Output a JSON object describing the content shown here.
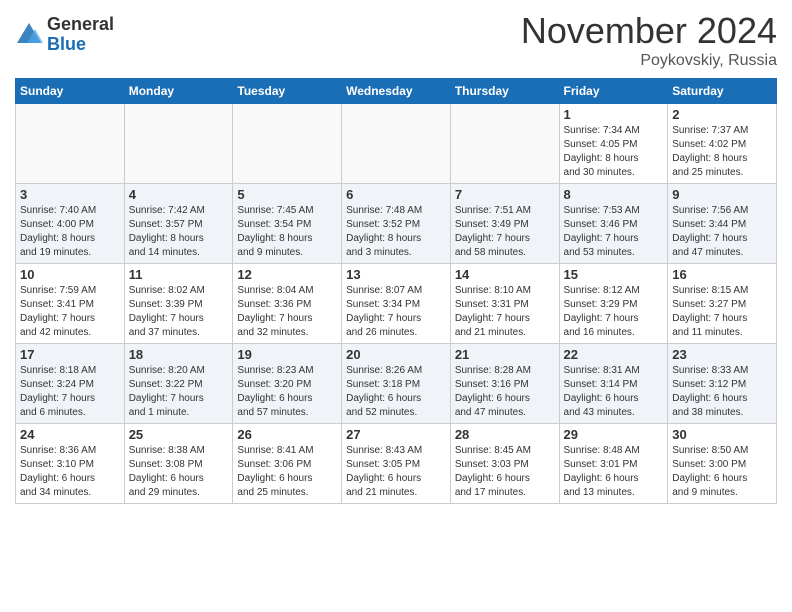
{
  "header": {
    "logo_general": "General",
    "logo_blue": "Blue",
    "month_title": "November 2024",
    "location": "Poykovskiy, Russia"
  },
  "weekdays": [
    "Sunday",
    "Monday",
    "Tuesday",
    "Wednesday",
    "Thursday",
    "Friday",
    "Saturday"
  ],
  "weeks": [
    {
      "shade": false,
      "days": [
        {
          "num": "",
          "info": ""
        },
        {
          "num": "",
          "info": ""
        },
        {
          "num": "",
          "info": ""
        },
        {
          "num": "",
          "info": ""
        },
        {
          "num": "",
          "info": ""
        },
        {
          "num": "1",
          "info": "Sunrise: 7:34 AM\nSunset: 4:05 PM\nDaylight: 8 hours\nand 30 minutes."
        },
        {
          "num": "2",
          "info": "Sunrise: 7:37 AM\nSunset: 4:02 PM\nDaylight: 8 hours\nand 25 minutes."
        }
      ]
    },
    {
      "shade": true,
      "days": [
        {
          "num": "3",
          "info": "Sunrise: 7:40 AM\nSunset: 4:00 PM\nDaylight: 8 hours\nand 19 minutes."
        },
        {
          "num": "4",
          "info": "Sunrise: 7:42 AM\nSunset: 3:57 PM\nDaylight: 8 hours\nand 14 minutes."
        },
        {
          "num": "5",
          "info": "Sunrise: 7:45 AM\nSunset: 3:54 PM\nDaylight: 8 hours\nand 9 minutes."
        },
        {
          "num": "6",
          "info": "Sunrise: 7:48 AM\nSunset: 3:52 PM\nDaylight: 8 hours\nand 3 minutes."
        },
        {
          "num": "7",
          "info": "Sunrise: 7:51 AM\nSunset: 3:49 PM\nDaylight: 7 hours\nand 58 minutes."
        },
        {
          "num": "8",
          "info": "Sunrise: 7:53 AM\nSunset: 3:46 PM\nDaylight: 7 hours\nand 53 minutes."
        },
        {
          "num": "9",
          "info": "Sunrise: 7:56 AM\nSunset: 3:44 PM\nDaylight: 7 hours\nand 47 minutes."
        }
      ]
    },
    {
      "shade": false,
      "days": [
        {
          "num": "10",
          "info": "Sunrise: 7:59 AM\nSunset: 3:41 PM\nDaylight: 7 hours\nand 42 minutes."
        },
        {
          "num": "11",
          "info": "Sunrise: 8:02 AM\nSunset: 3:39 PM\nDaylight: 7 hours\nand 37 minutes."
        },
        {
          "num": "12",
          "info": "Sunrise: 8:04 AM\nSunset: 3:36 PM\nDaylight: 7 hours\nand 32 minutes."
        },
        {
          "num": "13",
          "info": "Sunrise: 8:07 AM\nSunset: 3:34 PM\nDaylight: 7 hours\nand 26 minutes."
        },
        {
          "num": "14",
          "info": "Sunrise: 8:10 AM\nSunset: 3:31 PM\nDaylight: 7 hours\nand 21 minutes."
        },
        {
          "num": "15",
          "info": "Sunrise: 8:12 AM\nSunset: 3:29 PM\nDaylight: 7 hours\nand 16 minutes."
        },
        {
          "num": "16",
          "info": "Sunrise: 8:15 AM\nSunset: 3:27 PM\nDaylight: 7 hours\nand 11 minutes."
        }
      ]
    },
    {
      "shade": true,
      "days": [
        {
          "num": "17",
          "info": "Sunrise: 8:18 AM\nSunset: 3:24 PM\nDaylight: 7 hours\nand 6 minutes."
        },
        {
          "num": "18",
          "info": "Sunrise: 8:20 AM\nSunset: 3:22 PM\nDaylight: 7 hours\nand 1 minute."
        },
        {
          "num": "19",
          "info": "Sunrise: 8:23 AM\nSunset: 3:20 PM\nDaylight: 6 hours\nand 57 minutes."
        },
        {
          "num": "20",
          "info": "Sunrise: 8:26 AM\nSunset: 3:18 PM\nDaylight: 6 hours\nand 52 minutes."
        },
        {
          "num": "21",
          "info": "Sunrise: 8:28 AM\nSunset: 3:16 PM\nDaylight: 6 hours\nand 47 minutes."
        },
        {
          "num": "22",
          "info": "Sunrise: 8:31 AM\nSunset: 3:14 PM\nDaylight: 6 hours\nand 43 minutes."
        },
        {
          "num": "23",
          "info": "Sunrise: 8:33 AM\nSunset: 3:12 PM\nDaylight: 6 hours\nand 38 minutes."
        }
      ]
    },
    {
      "shade": false,
      "days": [
        {
          "num": "24",
          "info": "Sunrise: 8:36 AM\nSunset: 3:10 PM\nDaylight: 6 hours\nand 34 minutes."
        },
        {
          "num": "25",
          "info": "Sunrise: 8:38 AM\nSunset: 3:08 PM\nDaylight: 6 hours\nand 29 minutes."
        },
        {
          "num": "26",
          "info": "Sunrise: 8:41 AM\nSunset: 3:06 PM\nDaylight: 6 hours\nand 25 minutes."
        },
        {
          "num": "27",
          "info": "Sunrise: 8:43 AM\nSunset: 3:05 PM\nDaylight: 6 hours\nand 21 minutes."
        },
        {
          "num": "28",
          "info": "Sunrise: 8:45 AM\nSunset: 3:03 PM\nDaylight: 6 hours\nand 17 minutes."
        },
        {
          "num": "29",
          "info": "Sunrise: 8:48 AM\nSunset: 3:01 PM\nDaylight: 6 hours\nand 13 minutes."
        },
        {
          "num": "30",
          "info": "Sunrise: 8:50 AM\nSunset: 3:00 PM\nDaylight: 6 hours\nand 9 minutes."
        }
      ]
    }
  ]
}
